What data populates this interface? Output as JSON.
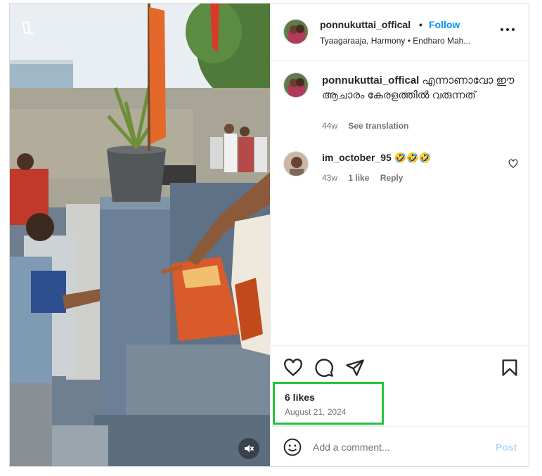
{
  "header": {
    "username": "ponnukuttai_offical",
    "separator": "•",
    "follow_label": "Follow",
    "location": "Tyaagaraaja, Harmony • Endharo Mah...",
    "more_icon": "more-horizontal-icon"
  },
  "caption": {
    "username": "ponnukuttai_offical",
    "text": "എന്നാണാവോ ഈ ആചാരം കേരളത്തിൽ വരുന്നത്",
    "age": "44w",
    "translate_label": "See translation"
  },
  "comments": [
    {
      "username": "im_october_95",
      "text": "🤣🤣🤣",
      "age": "43w",
      "likes": "1 like",
      "reply_label": "Reply"
    }
  ],
  "actions": {
    "like_icon": "heart-icon",
    "comment_icon": "comment-icon",
    "share_icon": "share-icon",
    "save_icon": "bookmark-icon"
  },
  "stats": {
    "likes": "6 likes",
    "date": "August 21, 2024"
  },
  "add_comment": {
    "placeholder": "Add a comment...",
    "post_label": "Post"
  },
  "media": {
    "mute_icon": "muted-speaker-icon"
  },
  "colors": {
    "accent": "#0095f6",
    "post_disabled": "#b3dbff",
    "highlight_box": "#22c43a",
    "muted_text": "#737373"
  }
}
